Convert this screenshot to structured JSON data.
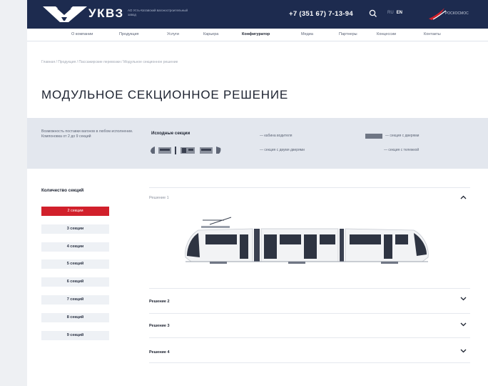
{
  "header": {
    "brand": "УКВЗ",
    "brand_sub": "АО Усть-Катавский вагоностроительный завод",
    "phone": "+7 (351 67) 7-13-94",
    "lang_inactive": "RU",
    "lang_active": "EN",
    "partner": "РОСКОСМОС"
  },
  "nav": [
    "О компании",
    "Продукция",
    "Услуги",
    "Карьера",
    "Конфигуратор",
    "Медиа",
    "Партнеры",
    "Концессии",
    "Контакты"
  ],
  "nav_active_index": 4,
  "breadcrumb": "Главная / Продукция / Пассажирские перевозки / Модульное секционное решение",
  "page_title": "МОДУЛЬНОЕ СЕКЦИОННОЕ РЕШЕНИЕ",
  "band": {
    "text_line1": "Возможность поставки вагонов в любом исполнении.",
    "text_line2": "Компоновка от 2 до 9 секций",
    "head": "Исходные секции",
    "legend_cabin": "— кабина водителя",
    "legend_two_doors": "— секция с двумя дверями",
    "legend_doors": "— секция с дверями",
    "legend_bogie": "— секция с тележкой"
  },
  "sidebar": {
    "title": "Количество секций",
    "options": [
      "2 секции",
      "3 секции",
      "4 секции",
      "5 секций",
      "6 секций",
      "7 секций",
      "8 секций",
      "9 секций"
    ],
    "selected_index": 0
  },
  "solutions": [
    "Решение 1",
    "Решение 2",
    "Решение 3",
    "Решение 4"
  ],
  "expanded_index": 0,
  "colors": {
    "navy": "#1d2b4f",
    "accent_red": "#d1202b",
    "band": "#e3e7ee"
  }
}
